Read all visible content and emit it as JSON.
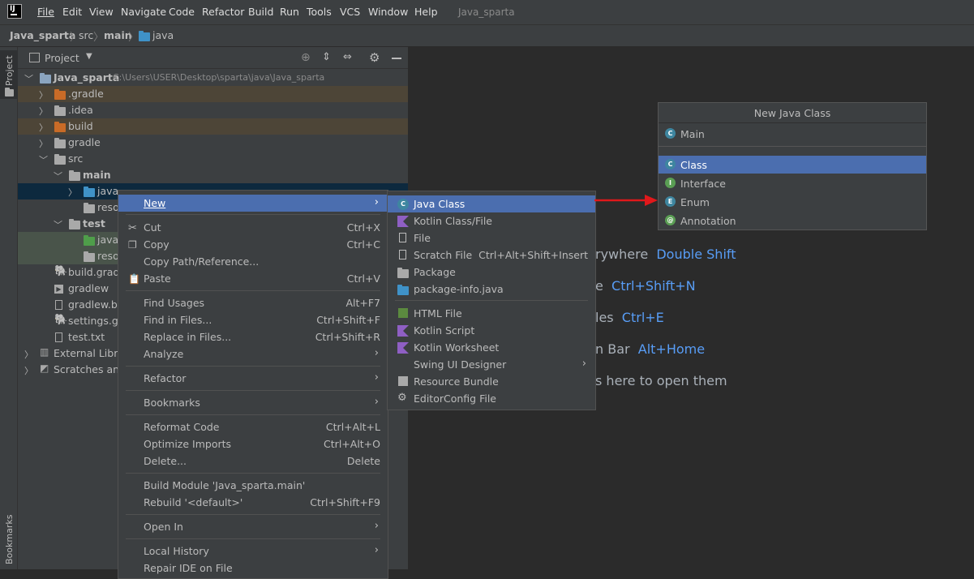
{
  "menubar": {
    "items": [
      "File",
      "Edit",
      "View",
      "Navigate",
      "Code",
      "Refactor",
      "Build",
      "Run",
      "Tools",
      "VCS",
      "Window",
      "Help"
    ],
    "project_name": "Java_sparta"
  },
  "breadcrumb": [
    "Java_sparta",
    "src",
    "main",
    "java"
  ],
  "tool_stripe": {
    "project": "Project",
    "bookmarks": "Bookmarks"
  },
  "project_panel": {
    "title": "Project",
    "tree": [
      {
        "label": "Java_sparta",
        "path": "C:\\Users\\USER\\Desktop\\sparta\\java\\Java_sparta"
      },
      {
        "label": ".gradle"
      },
      {
        "label": ".idea"
      },
      {
        "label": "build"
      },
      {
        "label": "gradle"
      },
      {
        "label": "src"
      },
      {
        "label": "main"
      },
      {
        "label": "java"
      },
      {
        "label": "resou"
      },
      {
        "label": "test"
      },
      {
        "label": "java"
      },
      {
        "label": "resou"
      },
      {
        "label": "build.gradle"
      },
      {
        "label": "gradlew"
      },
      {
        "label": "gradlew.bat"
      },
      {
        "label": "settings.gra"
      },
      {
        "label": "test.txt"
      },
      {
        "label": "External Librari"
      },
      {
        "label": "Scratches and"
      }
    ]
  },
  "editor_hints": [
    {
      "text": "rywhere",
      "key": "Double Shift"
    },
    {
      "text": "e",
      "key": "Ctrl+Shift+N"
    },
    {
      "text": "les",
      "key": "Ctrl+E"
    },
    {
      "text": "n Bar",
      "key": "Alt+Home"
    },
    {
      "text": "s here to open them",
      "key": ""
    }
  ],
  "context_menu": {
    "items": [
      {
        "label": "New",
        "shortcut": "",
        "submenu": true
      },
      {
        "label": "Cut",
        "shortcut": "Ctrl+X"
      },
      {
        "label": "Copy",
        "shortcut": "Ctrl+C"
      },
      {
        "label": "Copy Path/Reference...",
        "shortcut": ""
      },
      {
        "label": "Paste",
        "shortcut": "Ctrl+V"
      },
      {
        "label": "Find Usages",
        "shortcut": "Alt+F7"
      },
      {
        "label": "Find in Files...",
        "shortcut": "Ctrl+Shift+F"
      },
      {
        "label": "Replace in Files...",
        "shortcut": "Ctrl+Shift+R"
      },
      {
        "label": "Analyze",
        "shortcut": "",
        "submenu": true
      },
      {
        "label": "Refactor",
        "shortcut": "",
        "submenu": true
      },
      {
        "label": "Bookmarks",
        "shortcut": "",
        "submenu": true
      },
      {
        "label": "Reformat Code",
        "shortcut": "Ctrl+Alt+L"
      },
      {
        "label": "Optimize Imports",
        "shortcut": "Ctrl+Alt+O"
      },
      {
        "label": "Delete...",
        "shortcut": "Delete"
      },
      {
        "label": "Build Module 'Java_sparta.main'",
        "shortcut": ""
      },
      {
        "label": "Rebuild '<default>'",
        "shortcut": "Ctrl+Shift+F9"
      },
      {
        "label": "Open In",
        "shortcut": "",
        "submenu": true
      },
      {
        "label": "Local History",
        "shortcut": "",
        "submenu": true
      },
      {
        "label": "Repair IDE on File",
        "shortcut": ""
      }
    ]
  },
  "new_submenu": {
    "items": [
      {
        "label": "Java Class",
        "shortcut": ""
      },
      {
        "label": "Kotlin Class/File",
        "shortcut": ""
      },
      {
        "label": "File",
        "shortcut": ""
      },
      {
        "label": "Scratch File",
        "shortcut": "Ctrl+Alt+Shift+Insert"
      },
      {
        "label": "Package",
        "shortcut": ""
      },
      {
        "label": "package-info.java",
        "shortcut": ""
      },
      {
        "label": "HTML File",
        "shortcut": ""
      },
      {
        "label": "Kotlin Script",
        "shortcut": ""
      },
      {
        "label": "Kotlin Worksheet",
        "shortcut": ""
      },
      {
        "label": "Swing UI Designer",
        "shortcut": "",
        "submenu": true
      },
      {
        "label": "Resource Bundle",
        "shortcut": ""
      },
      {
        "label": "EditorConfig File",
        "shortcut": ""
      }
    ]
  },
  "new_java_class": {
    "title": "New Java Class",
    "input_value": "Main",
    "options": [
      "Class",
      "Interface",
      "Enum",
      "Annotation"
    ]
  },
  "colors": {
    "accent": "#4b6eaf",
    "arrow": "#e0181b",
    "key": "#589df6"
  }
}
